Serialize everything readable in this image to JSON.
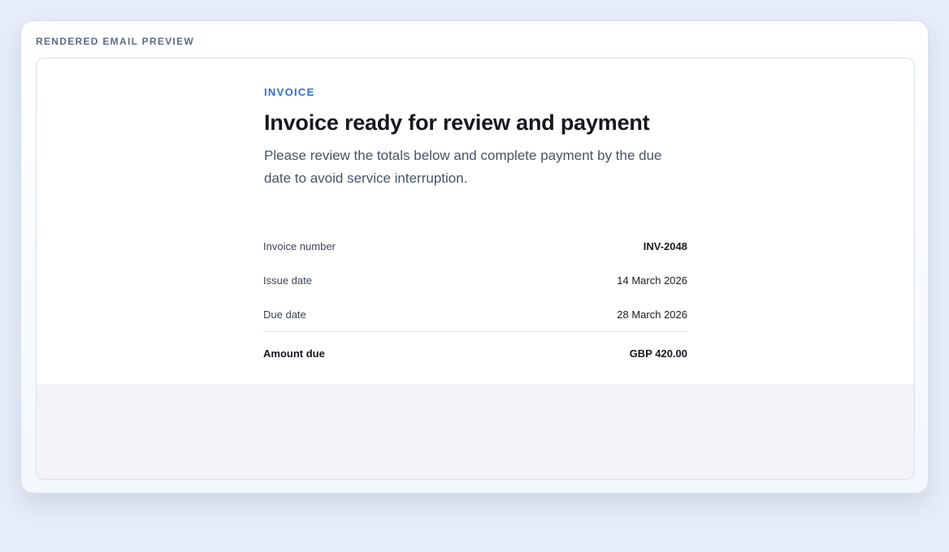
{
  "panel": {
    "label": "RENDERED EMAIL PREVIEW"
  },
  "email": {
    "eyebrow": "INVOICE",
    "headline": "Invoice ready for review and payment",
    "intro": "Please review the totals below and complete payment by the due date to avoid service interruption.",
    "summary": {
      "rows": [
        {
          "label": "Invoice number",
          "value": "INV-2048"
        },
        {
          "label": "Issue date",
          "value": "14 March 2026"
        },
        {
          "label": "Due date",
          "value": "28 March 2026"
        }
      ],
      "total": {
        "label": "Amount due",
        "value": "GBP 420.00"
      }
    }
  },
  "colors": {
    "page_background": "#e8eef9",
    "accent": "#2f6fd6",
    "heading": "#15181d",
    "muted_text": "#465467",
    "footer_background": "#f2f4f7"
  }
}
